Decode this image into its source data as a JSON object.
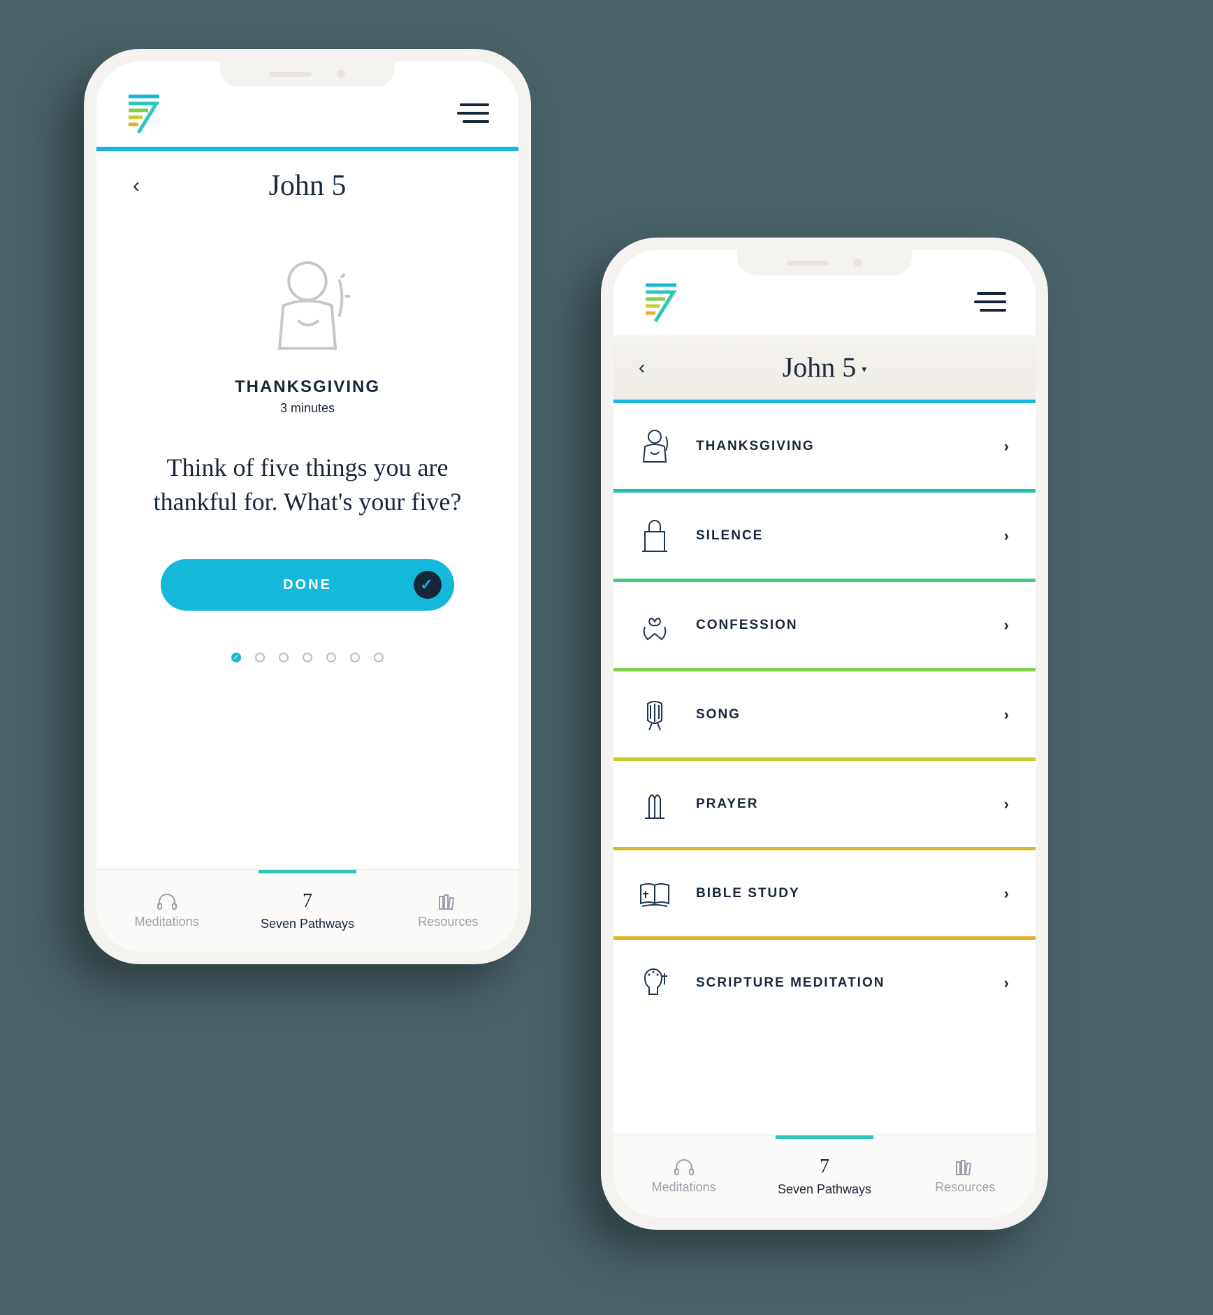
{
  "colors": {
    "accent": "#14b8d8",
    "teal_rule": "#2cc7b9",
    "text_dark": "#18263a"
  },
  "phone_left": {
    "page_title": "John 5",
    "section_label": "THANKSGIVING",
    "duration": "3 minutes",
    "prompt": "Think of five things you are thankful for. What's your five?",
    "done_label": "DONE",
    "pager_total": 7,
    "pager_active": 0
  },
  "nav": {
    "items": [
      {
        "label": "Meditations",
        "icon": "headphones-icon"
      },
      {
        "label": "Seven Pathways",
        "icon": "seven-glyph"
      },
      {
        "label": "Resources",
        "icon": "books-icon"
      }
    ],
    "active_index": 1
  },
  "phone_right": {
    "page_title": "John 5",
    "pathways": [
      {
        "label": "THANKSGIVING",
        "color": "#14b8d8",
        "icon": "thanksgiving-icon"
      },
      {
        "label": "SILENCE",
        "color": "#1fc2b4",
        "icon": "silence-icon"
      },
      {
        "label": "CONFESSION",
        "color": "#46cb7a",
        "icon": "confession-icon"
      },
      {
        "label": "SONG",
        "color": "#7fcf4a",
        "icon": "song-icon"
      },
      {
        "label": "PRAYER",
        "color": "#c5cc2e",
        "icon": "prayer-icon"
      },
      {
        "label": "BIBLE STUDY",
        "color": "#d7b82a",
        "icon": "bible-study-icon"
      },
      {
        "label": "SCRIPTURE MEDITATION",
        "color": "#e7b02a",
        "icon": "scripture-meditation-icon"
      }
    ]
  }
}
